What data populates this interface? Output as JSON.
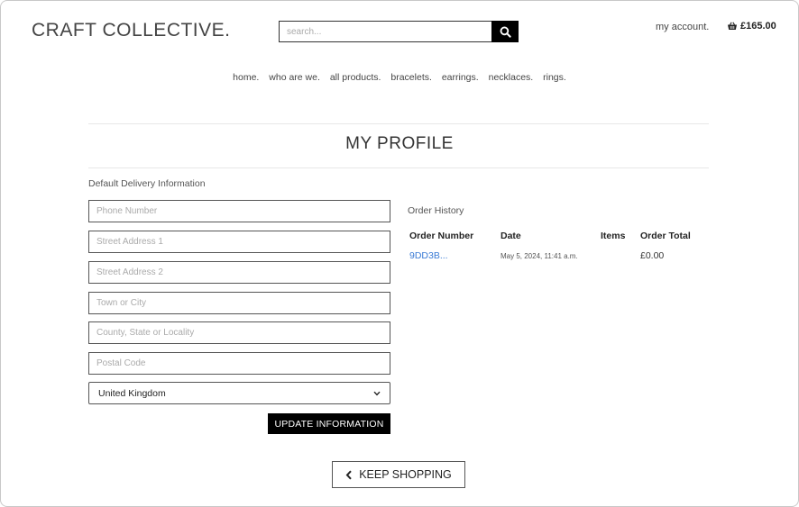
{
  "header": {
    "logo": "CRAFT COLLECTIVE.",
    "search_placeholder": "search...",
    "account_label": "my account.",
    "cart_total": "£165.00"
  },
  "nav": {
    "items": [
      "home.",
      "who are we.",
      "all products.",
      "bracelets.",
      "earrings.",
      "necklaces.",
      "rings."
    ]
  },
  "page": {
    "title": "MY PROFILE"
  },
  "delivery": {
    "heading": "Default Delivery Information",
    "fields": [
      {
        "placeholder": "Phone Number",
        "value": ""
      },
      {
        "placeholder": "Street Address 1",
        "value": ""
      },
      {
        "placeholder": "Street Address 2",
        "value": ""
      },
      {
        "placeholder": "Town or City",
        "value": ""
      },
      {
        "placeholder": "County, State or Locality",
        "value": ""
      },
      {
        "placeholder": "Postal Code",
        "value": ""
      }
    ],
    "country": "United Kingdom",
    "update_label": "UPDATE INFORMATION"
  },
  "orders": {
    "heading": "Order History",
    "columns": [
      "Order Number",
      "Date",
      "Items",
      "Order Total"
    ],
    "rows": [
      {
        "number": "9DD3B...",
        "date": "May 5, 2024, 11:41 a.m.",
        "items": "",
        "total": "£0.00"
      }
    ]
  },
  "footer": {
    "keep_shopping": "KEEP SHOPPING"
  },
  "colors": {
    "link": "#3a7bd5",
    "button_bg": "#000000"
  },
  "icons": {
    "search": "magnifier",
    "cart": "basket",
    "back": "chevron-left"
  }
}
